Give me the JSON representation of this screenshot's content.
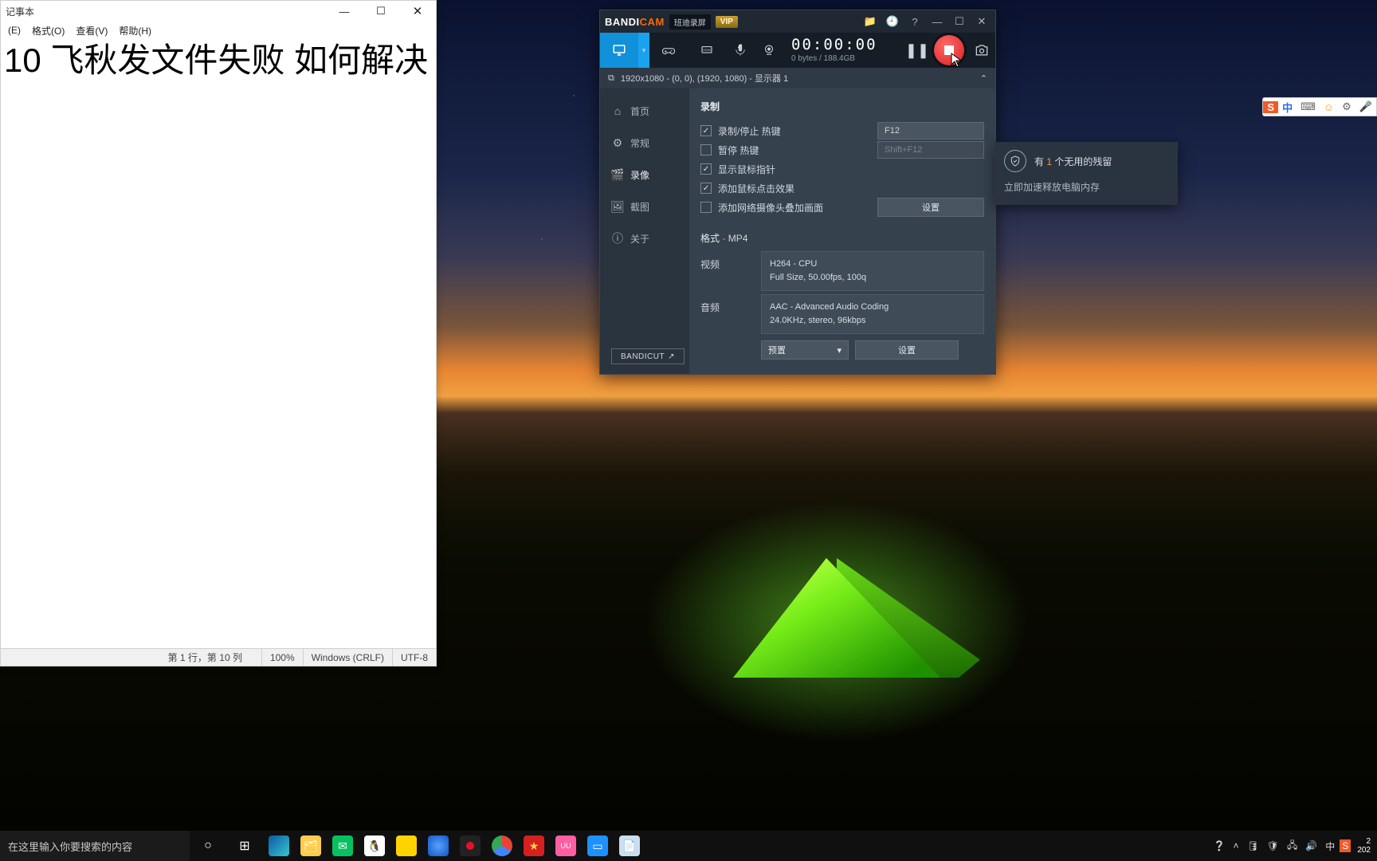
{
  "notepad": {
    "title": "记事本",
    "menu": {
      "edit": "(E)",
      "format": "格式(O)",
      "view": "查看(V)",
      "help": "帮助(H)"
    },
    "content": "10 飞秋发文件失败 如何解决",
    "status": {
      "pos": "第 1 行，第 10 列",
      "zoom": "100%",
      "eol": "Windows (CRLF)",
      "enc": "UTF-8"
    }
  },
  "bandicam": {
    "brand1": "BANDI",
    "brand2": "CAM",
    "badge": "班迪录屏",
    "vip": "VIP",
    "timer": "00:00:00",
    "size": "0 bytes / 188.4GB",
    "info": "1920x1080 - (0, 0), (1920, 1080) - 显示器 1",
    "side": {
      "home": "首页",
      "general": "常规",
      "video": "录像",
      "image": "截图",
      "about": "关于"
    },
    "section_rec": "录制",
    "chk": {
      "rec_hot": "录制/停止 热键",
      "pause_hot": "暂停 热键",
      "show_cursor": "显示鼠标指针",
      "click_fx": "添加鼠标点击效果",
      "webcam": "添加网络摄像头叠加画面"
    },
    "hotkey_rec": "F12",
    "hotkey_pause": "Shift+F12",
    "btn_settings": "设置",
    "format_hdr": "格式",
    "format_val": "MP4",
    "spec_video_k": "视频",
    "spec_video_v1": "H264 - CPU",
    "spec_video_v2": "Full Size, 50.00fps, 100q",
    "spec_audio_k": "音频",
    "spec_audio_v1": "AAC - Advanced Audio Coding",
    "spec_audio_v2": "24.0KHz, stereo, 96kbps",
    "btn_preset": "预置",
    "bandicut": "BANDICUT"
  },
  "secpop": {
    "pre": "有 ",
    "num": "1",
    "post": " 个无用的残留",
    "action": "立即加速释放电脑内存"
  },
  "ime": {
    "cn": "中",
    "key": "⌨",
    "face": "☺",
    "gear": "⚙",
    "mic": "🎤"
  },
  "taskbar": {
    "search_ph": "在这里输入你要搜索的内容",
    "clock_time": "2",
    "clock_date": "202"
  }
}
